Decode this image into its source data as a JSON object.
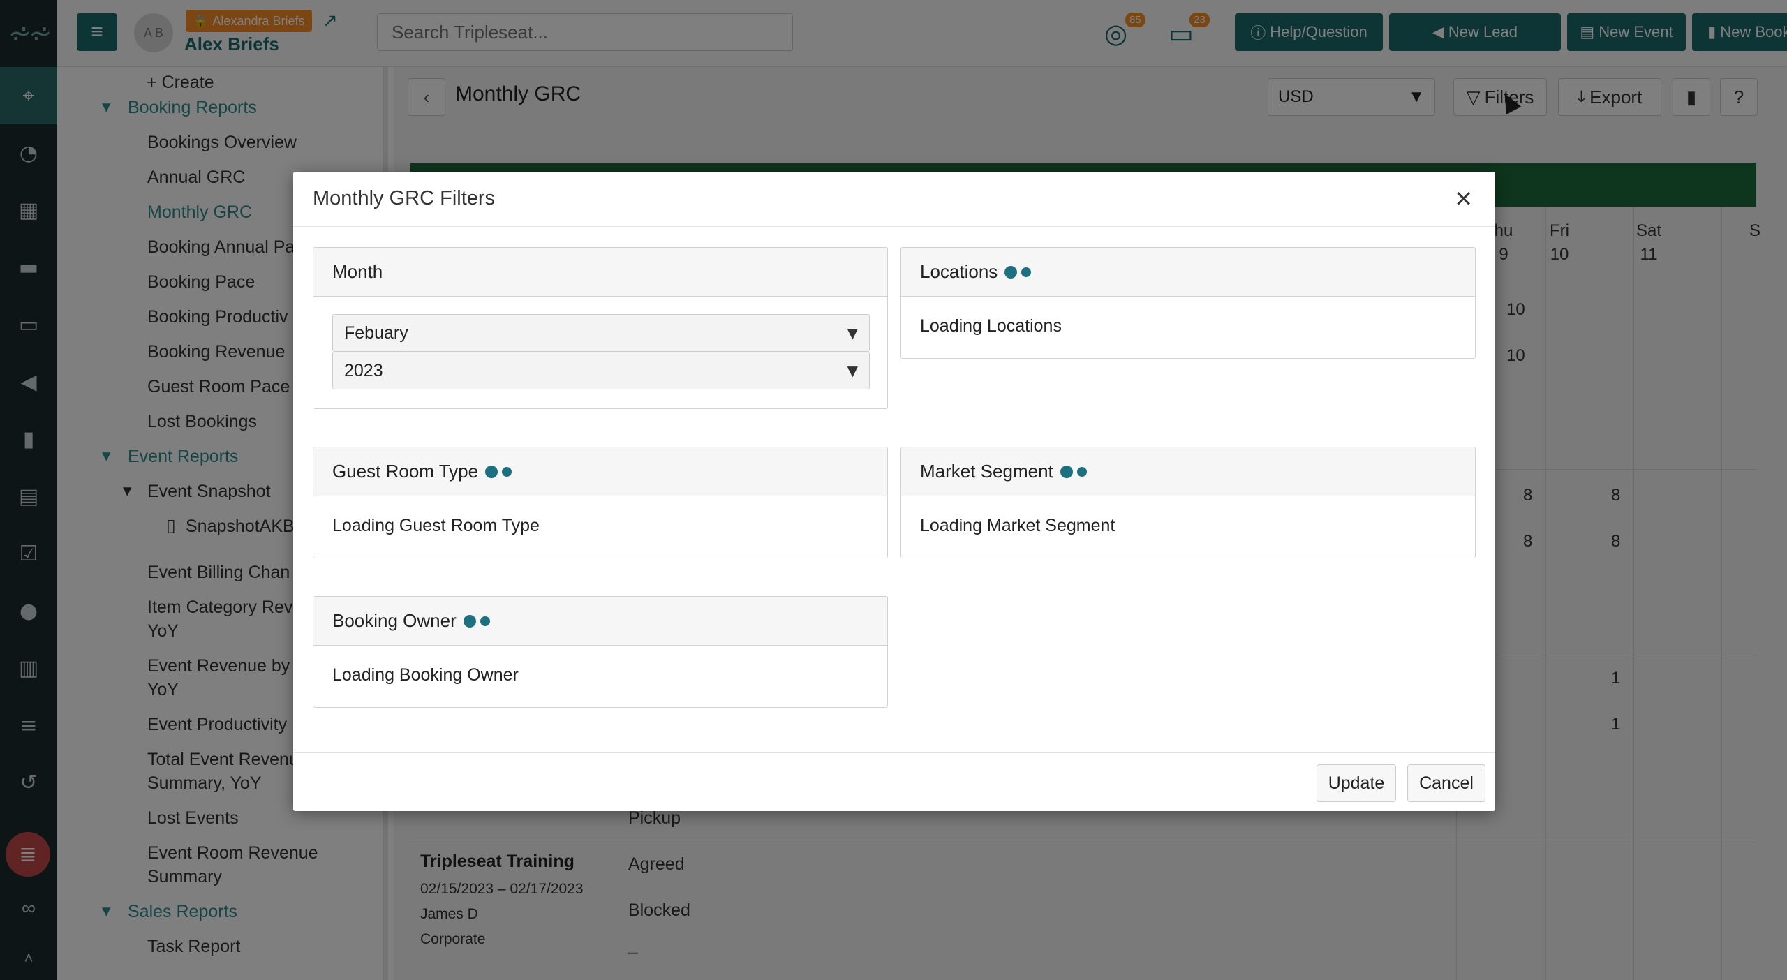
{
  "topbar": {
    "user_badge": "Alexandra Briefs",
    "user_name": "Alex Briefs",
    "avatar_initials": "A B",
    "search_placeholder": "Search Tripleseat...",
    "notif_count_1": "85",
    "notif_count_2": "23",
    "buttons": {
      "help": "Help/Question",
      "new_lead": "New Lead",
      "new_event": "New Event",
      "new_booking": "New Booking"
    }
  },
  "sidebar": {
    "create": "+ Create",
    "booking_reports": "Booking Reports",
    "bookings_overview": "Bookings Overview",
    "annual_grc": "Annual GRC",
    "monthly_grc": "Monthly GRC",
    "booking_annual_pace": "Booking Annual Pa",
    "booking_pace": "Booking Pace",
    "booking_productivity": "Booking Productiv",
    "booking_revenue": "Booking Revenue",
    "guest_room_pace": "Guest Room Pace",
    "lost_bookings": "Lost Bookings",
    "event_reports": "Event Reports",
    "event_snapshot": "Event Snapshot",
    "snapshot_akb": "SnapshotAKB",
    "event_billing": "Event Billing Chan",
    "item_category_1": "Item Category Rev",
    "item_category_2": "YoY",
    "event_revenue_1": "Event Revenue by",
    "event_revenue_2": "YoY",
    "event_productivity": "Event Productivity",
    "total_event_1": "Total Event Revenu",
    "total_event_2": "Summary, YoY",
    "lost_events": "Lost Events",
    "event_room_1": "Event Room Revenue",
    "event_room_2": "Summary",
    "sales_reports": "Sales Reports",
    "task_report": "Task Report"
  },
  "main": {
    "title": "Monthly GRC",
    "currency": "USD",
    "filters": "Filters",
    "export": "Export",
    "grid": {
      "thu_day": "hu",
      "thu_num": "9",
      "fri_day": "Fri",
      "fri_num": "10",
      "sat_day": "Sat",
      "sat_num": "11",
      "more_day": "S",
      "n10a": "10",
      "n10b": "10",
      "n8a": "8",
      "n8b": "8",
      "n8c": "8",
      "n8d": "8",
      "n1a": "1",
      "n1b": "1"
    },
    "booking": {
      "pickup": "Pickup",
      "title": "Tripleseat Training",
      "dates": "02/15/2023 – 02/17/2023",
      "owner": "James D",
      "segment": "Corporate",
      "agreed": "Agreed",
      "blocked": "Blocked",
      "dash": "–"
    }
  },
  "modal": {
    "title": "Monthly GRC Filters",
    "month_label": "Month",
    "month_value": "Febuary",
    "year_value": "2023",
    "locations_label": "Locations",
    "locations_loading": "Loading Locations",
    "guest_room_label": "Guest Room Type",
    "guest_room_loading": "Loading Guest Room Type",
    "market_label": "Market Segment",
    "market_loading": "Loading Market Segment",
    "owner_label": "Booking Owner",
    "owner_loading": "Loading Booking Owner",
    "update": "Update",
    "cancel": "Cancel"
  }
}
